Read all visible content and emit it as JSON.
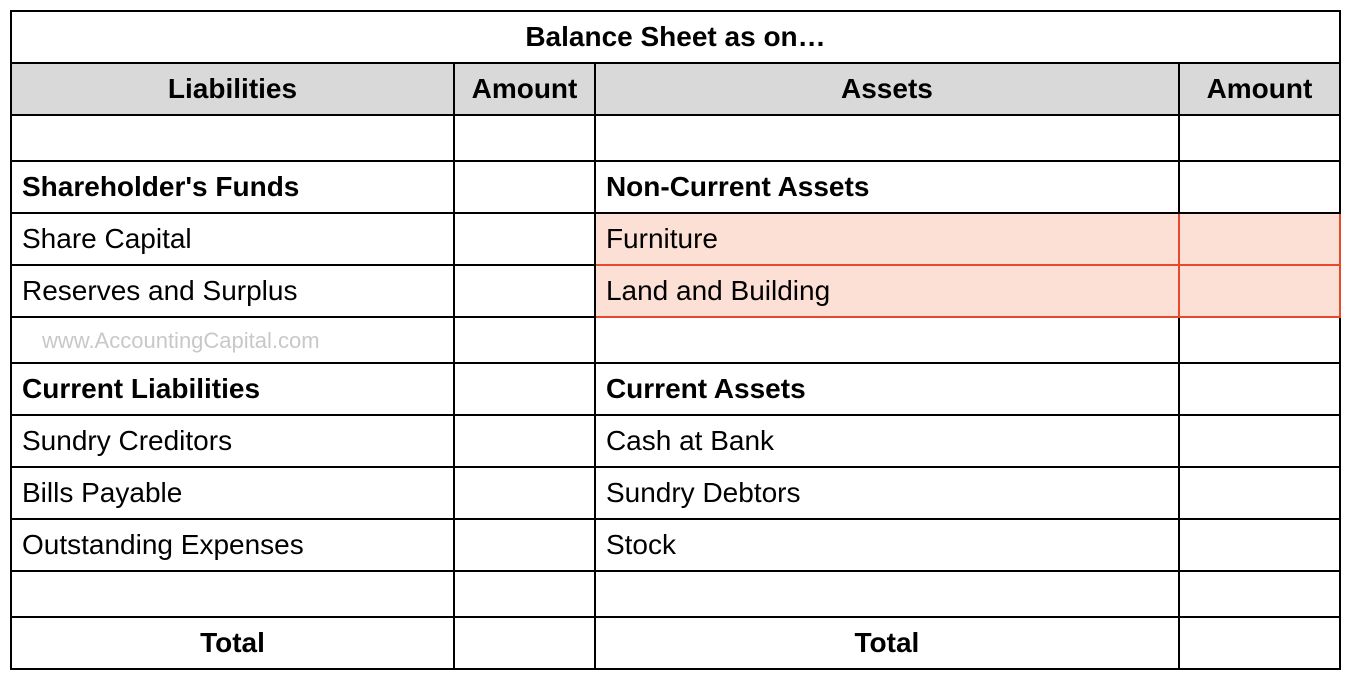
{
  "title": "Balance Sheet as on…",
  "headers": {
    "liabilities": "Liabilities",
    "amount1": "Amount",
    "assets": "Assets",
    "amount2": "Amount"
  },
  "liabilities": {
    "section1_header": "Shareholder's Funds",
    "section1_items": [
      "Share Capital",
      "Reserves and Surplus"
    ],
    "section2_header": "Current Liabilities",
    "section2_items": [
      "Sundry Creditors",
      "Bills Payable",
      "Outstanding Expenses"
    ]
  },
  "assets": {
    "section1_header": "Non-Current Assets",
    "section1_items": [
      "Furniture",
      "Land and Building"
    ],
    "section2_header": "Current Assets",
    "section2_items": [
      "Cash at Bank",
      "Sundry Debtors",
      "Stock"
    ]
  },
  "watermark": "www.AccountingCapital.com",
  "totals": {
    "liabilities": "Total",
    "assets": "Total"
  }
}
